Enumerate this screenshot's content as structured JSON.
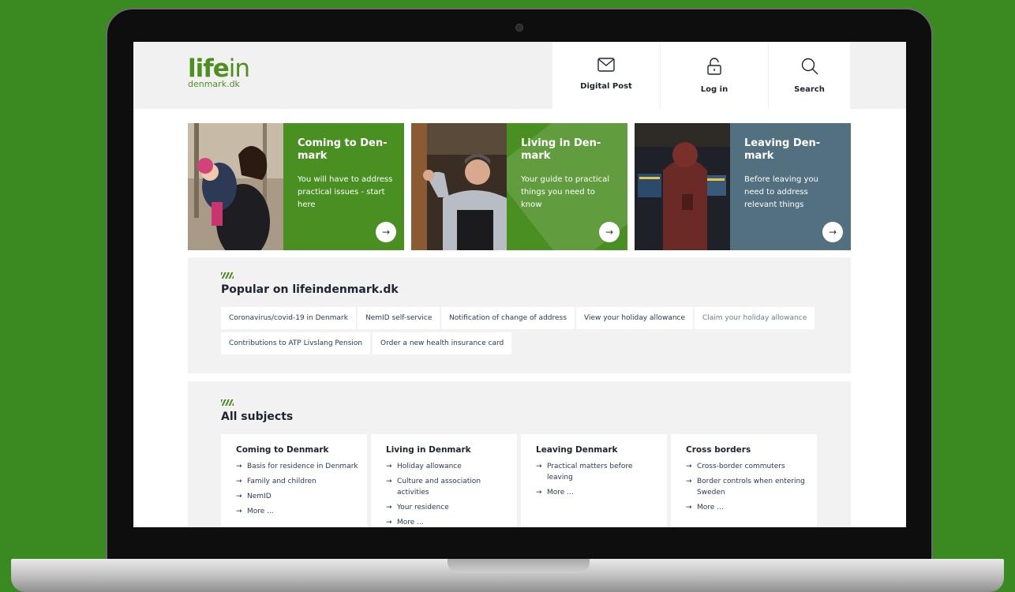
{
  "logo": {
    "top_bold": "life",
    "top_light": "in",
    "bottom": "denmark.dk"
  },
  "header": {
    "digital_post": "Digital Post",
    "login": "Log in",
    "search": "Search"
  },
  "hero": [
    {
      "title": "Coming to Den-mark",
      "text": "You will have to address practical issues - start here",
      "color": "#4a8f22"
    },
    {
      "title": "Living in Den-mark",
      "text": "Your guide to practical things you need to know",
      "color": "#4a8f22"
    },
    {
      "title": "Leaving Den-mark",
      "text": "Before leaving you need to address relevant things",
      "color": "#52707f"
    }
  ],
  "popular": {
    "title": "Popular on lifeindenmark.dk",
    "links": [
      "Coronavirus/covid-19 in Denmark",
      "NemID self-service",
      "Notification of change of address",
      "View your holiday allowance",
      "Claim your holiday allowance",
      "Contributions to ATP Livslang Pension",
      "Order a new health insurance card"
    ]
  },
  "subjects": {
    "title": "All subjects",
    "cards": [
      {
        "title": "Coming to Denmark",
        "items": [
          "Basis for residence in Denmark",
          "Family and children",
          "NemID",
          "More ..."
        ]
      },
      {
        "title": "Living in Denmark",
        "items": [
          "Holiday allowance",
          "Culture and association activities",
          "Your residence",
          "More ..."
        ]
      },
      {
        "title": "Leaving Denmark",
        "items": [
          "Practical matters before leaving",
          "More ..."
        ]
      },
      {
        "title": "Cross borders",
        "items": [
          "Cross-border commuters",
          "Border controls when entering Sweden",
          "More ..."
        ]
      }
    ]
  },
  "colors": {
    "brand_green": "#4a8f22",
    "slate": "#52707f",
    "background": "#3a8a22"
  }
}
